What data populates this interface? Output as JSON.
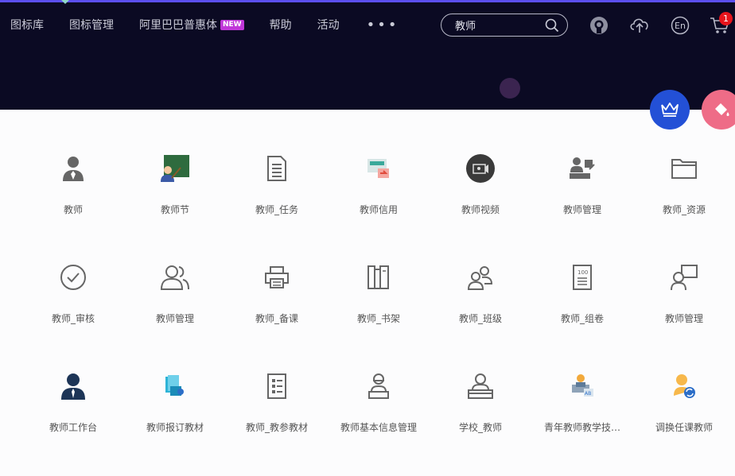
{
  "nav": {
    "items": [
      "图标库",
      "图标管理",
      "阿里巴巴普惠体",
      "帮助",
      "活动"
    ],
    "new_badge": "NEW",
    "more": "•••"
  },
  "search": {
    "value": "教师",
    "placeholder": "教师"
  },
  "cart": {
    "count": "1"
  },
  "language_button": "En",
  "colors": {
    "topbar": "#0b0a23",
    "accent": "#5b4ff0",
    "crown_button": "#2350d6",
    "paint_button": "#ee6c87",
    "badge_new": "#c037d8"
  },
  "icons": [
    {
      "label": "教师",
      "icon": "teacher-person-icon"
    },
    {
      "label": "教师节",
      "icon": "teachers-day-blackboard-icon"
    },
    {
      "label": "教师_任务",
      "icon": "task-document-icon"
    },
    {
      "label": "教师信用",
      "icon": "credit-screen-icon"
    },
    {
      "label": "教师视频",
      "icon": "video-circle-icon"
    },
    {
      "label": "教师管理",
      "icon": "teacher-desk-icon"
    },
    {
      "label": "教师_资源",
      "icon": "folder-icon"
    },
    {
      "label": "教师_审核",
      "icon": "check-circle-icon"
    },
    {
      "label": "教师管理",
      "icon": "people-group-icon"
    },
    {
      "label": "教师_备课",
      "icon": "printer-icon"
    },
    {
      "label": "教师_书架",
      "icon": "bookshelf-icon"
    },
    {
      "label": "教师_班级",
      "icon": "class-group-icon"
    },
    {
      "label": "教师_组卷",
      "icon": "exam-paper-icon"
    },
    {
      "label": "教师管理",
      "icon": "presenter-board-icon"
    },
    {
      "label": "教师工作台",
      "icon": "workbench-person-icon"
    },
    {
      "label": "教师报订教材",
      "icon": "textbook-order-icon"
    },
    {
      "label": "教师_教参教材",
      "icon": "reference-book-icon"
    },
    {
      "label": "教师基本信息管理",
      "icon": "info-management-icon"
    },
    {
      "label": "学校_教师",
      "icon": "school-teacher-icon"
    },
    {
      "label": "青年教师教学技…",
      "icon": "young-teacher-icon"
    },
    {
      "label": "调换任课教师",
      "icon": "swap-teacher-icon"
    }
  ]
}
